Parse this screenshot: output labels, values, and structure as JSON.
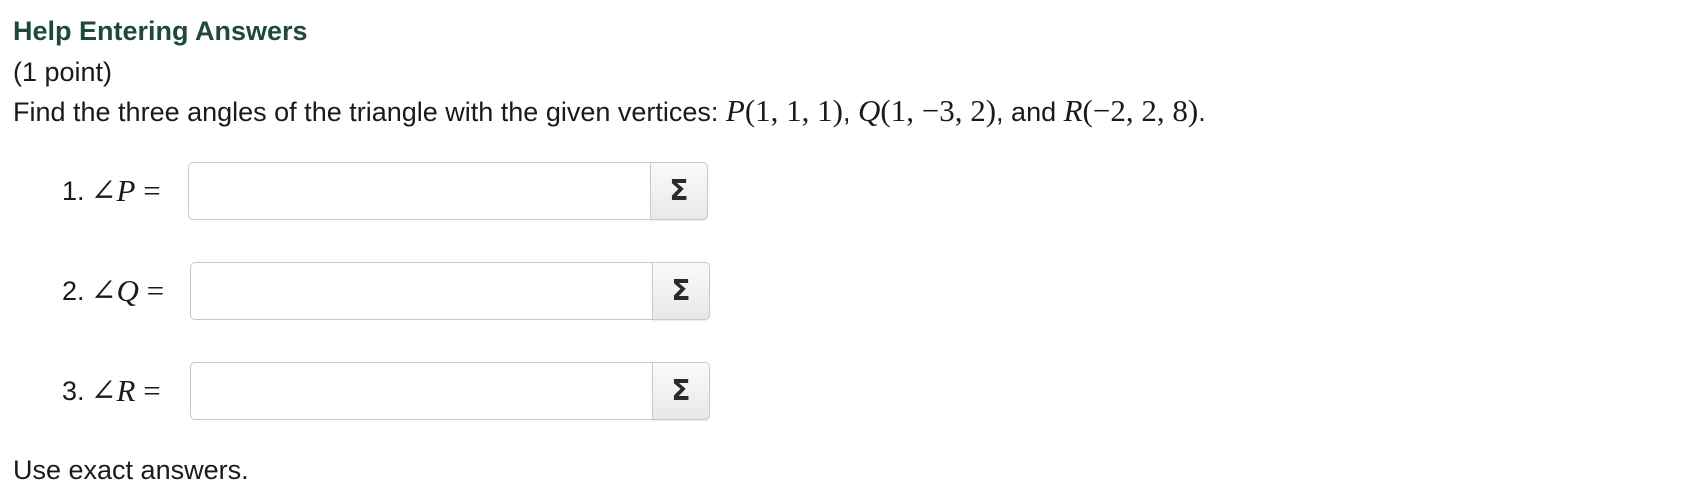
{
  "header": {
    "help_link": "Help Entering Answers",
    "points": "(1 point)"
  },
  "problem": {
    "text_before": "Find the three angles of the triangle with the given vertices: ",
    "vertex_p": {
      "name": "P",
      "coords": "(1, 1, 1)"
    },
    "sep1": ", ",
    "vertex_q": {
      "name": "Q",
      "coords": "(1, −3, 2)"
    },
    "sep2": ", and ",
    "vertex_r": {
      "name": "R",
      "coords": "(−2, 2, 8)"
    },
    "end": "."
  },
  "answers": [
    {
      "number": "1.",
      "angle": "∠",
      "vertex": "P",
      "equals": " =",
      "value": "",
      "button_icon": "sigma-icon",
      "button_glyph": "Σ"
    },
    {
      "number": "2.",
      "angle": "∠",
      "vertex": "Q",
      "equals": " =",
      "value": "",
      "button_icon": "sigma-icon",
      "button_glyph": "Σ"
    },
    {
      "number": "3.",
      "angle": "∠",
      "vertex": "R",
      "equals": " =",
      "value": "",
      "button_icon": "sigma-icon",
      "button_glyph": "Σ"
    }
  ],
  "footer": {
    "note": "Use exact answers."
  },
  "colors": {
    "help_link": "#1f4a3a",
    "text": "#1a1a1a",
    "input_border": "#c8c8c8"
  }
}
